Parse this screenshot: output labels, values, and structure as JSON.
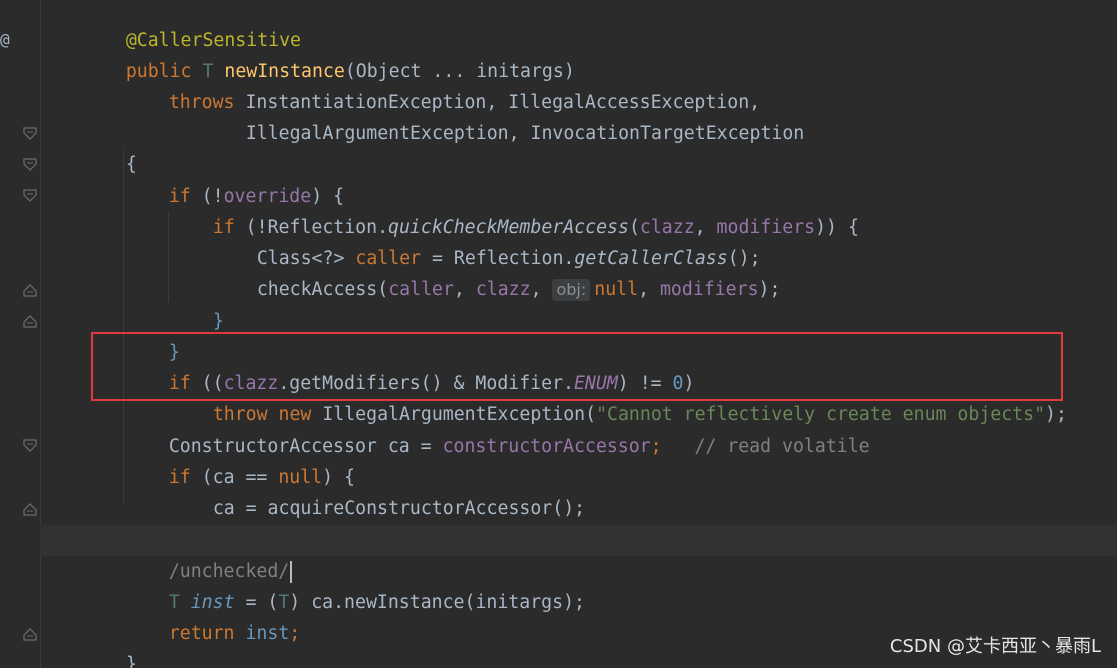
{
  "gutter": {
    "override_marker": "@"
  },
  "code": {
    "annotation": "@CallerSensitive",
    "sig_public": "public",
    "sig_type": "T",
    "sig_method": "newInstance",
    "sig_params_open": "(Object ... ",
    "sig_param_name": "initargs",
    "sig_close": ")",
    "throws_kw": "throws",
    "throws_line1": "InstantiationException, IllegalAccessException,",
    "throws_line2": "IllegalArgumentException, InvocationTargetException",
    "open_brace": "{",
    "if_kw": "if",
    "override_cond_open": "(!",
    "override_field": "override",
    "override_cond_close": ") {",
    "if2_kw": "if",
    "reflection_open": "(!Reflection.",
    "quick_check": "quickCheckMemberAccess",
    "reflection_args_open": "(",
    "clazz": "clazz",
    "comma_sp": ", ",
    "modifiers": "modifiers",
    "reflection_args_close": ")) {",
    "class_decl": "Class<?> ",
    "caller_var": "caller",
    "assign_reflection": " = Reflection.",
    "get_caller_class": "getCallerClass",
    "call_end": "();",
    "check_access": "checkAccess",
    "paren_open": "(",
    "caller_arg": "caller",
    "hint_obj": "obj:",
    "null_kw": "null",
    "modifiers_end": ");",
    "close_brace": "}",
    "enum_if_open": "((",
    "get_modifiers": ".getModifiers() & Modifier.",
    "enum_const": "ENUM",
    "neq": ") != ",
    "zero": "0",
    "enum_if_close": ")",
    "throw_kw": "throw",
    "new_kw": "new",
    "iae": " IllegalArgumentException(",
    "enum_msg": "\"Cannot reflectively create enum objects\"",
    "stmt_end": ");",
    "ctor_accessor_type": "ConstructorAccessor ",
    "ca_var": "ca",
    "assign": " = ",
    "ctor_accessor_field": "constructorAccessor",
    "semicolon": ";",
    "read_volatile_comment": "// read volatile",
    "if_ca_open": "(ca == ",
    "if_ca_close": ") {",
    "ca_assign": "ca = acquireConstructorAccessor",
    "unchecked_comment": "/unchecked/",
    "t_type": "T",
    "inst_var": "inst",
    "cast_open": " = (",
    "cast_close": ") ca.newInstance(",
    "initargs_arg": "initargs",
    "return_kw": "return",
    "return_inst": "inst"
  },
  "watermark": "CSDN @艾卡西亚丶暴雨L",
  "colors": {
    "background": "#2b2b2b",
    "keyword": "#cc7832",
    "string": "#6a8759",
    "highlight_box": "#e0393e"
  }
}
